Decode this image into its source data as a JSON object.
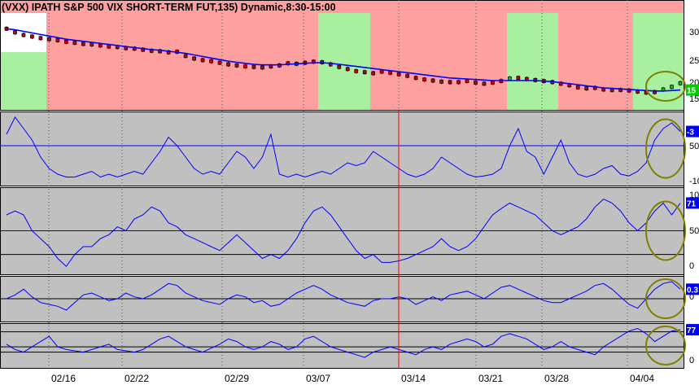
{
  "chart_data": {
    "type": "line",
    "title": "(VXX) IPATH S&P 500 VIX SHORT-TERM FUT,135) Dynamic,8:30-15:00",
    "x_tick_labels": [
      "02/16",
      "02/22",
      "02/29",
      "03/07",
      "03/14",
      "03/21",
      "03/28",
      "04/04"
    ],
    "n_bars": 80,
    "vertical_marker_label": "03/14",
    "background_regimes": [
      {
        "from": "start",
        "to": "02/16",
        "color": "#a8f0a0"
      },
      {
        "from": "02/16",
        "to": "03/07",
        "color": "#ffa0a0"
      },
      {
        "from": "03/07",
        "to": "03/14",
        "color": "#a8f0a0"
      },
      {
        "from": "03/14",
        "to": "03/21",
        "color": "#ffa0a0"
      },
      {
        "from": "03/21",
        "to": "03/28",
        "color": "#a8f0a0"
      },
      {
        "from": "03/28",
        "to": "04/04",
        "color": "#ffa0a0"
      },
      {
        "from": "04/04",
        "to": "end",
        "color": "#a8f0a0"
      }
    ],
    "panels": [
      {
        "name": "price",
        "y_tick_labels": [
          "30",
          "25",
          "20",
          "15"
        ],
        "ylim": [
          13.5,
          32
        ],
        "last_value_label": "15",
        "series": [
          {
            "name": "",
            "kind": "candles",
            "values": [
              29,
              28.3,
              27.8,
              27.5,
              27.2,
              27,
              26.8,
              26.5,
              26.3,
              26.1,
              26,
              25.8,
              25.6,
              25.5,
              25.3,
              25.2,
              25,
              24.8,
              24.7,
              24.5,
              24.6,
              23.8,
              23.3,
              23,
              22.8,
              22.5,
              22.2,
              22,
              21.8,
              21.7,
              21.6,
              21.8,
              22,
              22.4,
              22.3,
              22.5,
              22.7,
              22.6,
              22.2,
              21.7,
              21.3,
              20.9,
              20.7,
              20.5,
              20.8,
              20.6,
              20.3,
              20,
              19.6,
              19.3,
              19.1,
              18.9,
              18.8,
              18.8,
              19,
              18.7,
              18.5,
              18.7,
              19,
              19.5,
              19.6,
              19.4,
              19.2,
              19,
              18.8,
              18.5,
              18.2,
              17.8,
              17.6,
              17.7,
              17.4,
              17.3,
              17.3,
              17.2,
              17,
              16.8,
              16.9,
              17.4,
              17.9,
              18.6
            ]
          },
          {
            "name": "",
            "kind": "moving-average",
            "values": [
              29,
              28.8,
              28.5,
              28.2,
              27.9,
              27.6,
              27.3,
              27,
              26.8,
              26.6,
              26.4,
              26.2,
              26,
              25.8,
              25.6,
              25.4,
              25.2,
              25,
              24.9,
              24.7,
              24.5,
              24.3,
              24,
              23.7,
              23.4,
              23.1,
              22.8,
              22.6,
              22.4,
              22.2,
              22.1,
              22.1,
              22.1,
              22.2,
              22.3,
              22.4,
              22.5,
              22.5,
              22.4,
              22.2,
              22,
              21.8,
              21.6,
              21.4,
              21.2,
              21,
              20.8,
              20.6,
              20.4,
              20.2,
              20,
              19.8,
              19.6,
              19.5,
              19.4,
              19.3,
              19.2,
              19.1,
              19.1,
              19.1,
              19.1,
              19.1,
              19.1,
              19,
              18.9,
              18.7,
              18.5,
              18.3,
              18.1,
              17.9,
              17.7,
              17.6,
              17.5,
              17.4,
              17.3,
              17.2,
              17.1,
              17.1,
              17.2,
              17.3
            ]
          }
        ]
      },
      {
        "name": "indicator-1",
        "y_tick_labels": [
          "50",
          "-10"
        ],
        "ylim": [
          -20,
          110
        ],
        "ref_lines": [
          {
            "value": 50,
            "color": "#0000ff"
          }
        ],
        "last_value_label": "-3",
        "series": [
          {
            "name": "",
            "kind": "line",
            "values": [
              70,
              100,
              80,
              60,
              30,
              10,
              0,
              -5,
              -5,
              0,
              5,
              -5,
              0,
              -5,
              0,
              5,
              0,
              20,
              40,
              65,
              50,
              30,
              10,
              0,
              5,
              0,
              20,
              40,
              30,
              10,
              30,
              70,
              0,
              -5,
              0,
              -5,
              0,
              5,
              0,
              10,
              20,
              15,
              20,
              40,
              30,
              20,
              10,
              0,
              -5,
              0,
              10,
              30,
              20,
              10,
              0,
              -5,
              -3,
              0,
              10,
              50,
              80,
              40,
              30,
              0,
              30,
              60,
              20,
              0,
              -5,
              0,
              10,
              15,
              0,
              -3,
              5,
              20,
              60,
              80,
              90,
              75
            ]
          }
        ]
      },
      {
        "name": "indicator-2",
        "y_tick_labels": [
          "100",
          "50",
          "0"
        ],
        "ylim": [
          -5,
          105
        ],
        "ref_lines": [
          {
            "value": 50,
            "color": "#0000ff"
          },
          {
            "value": 20,
            "color": "#000000"
          }
        ],
        "last_value_label": "71",
        "series": [
          {
            "name": "",
            "kind": "line",
            "values": [
              70,
              75,
              70,
              50,
              40,
              30,
              15,
              5,
              20,
              30,
              30,
              40,
              45,
              55,
              50,
              65,
              70,
              80,
              75,
              60,
              55,
              45,
              40,
              35,
              30,
              25,
              35,
              45,
              35,
              25,
              15,
              20,
              15,
              25,
              40,
              60,
              75,
              80,
              70,
              55,
              40,
              25,
              15,
              20,
              10,
              10,
              12,
              15,
              20,
              25,
              30,
              40,
              30,
              25,
              30,
              40,
              55,
              70,
              78,
              85,
              80,
              75,
              70,
              60,
              50,
              45,
              50,
              55,
              65,
              80,
              90,
              85,
              75,
              60,
              50,
              60,
              75,
              85,
              70,
              85
            ]
          }
        ]
      },
      {
        "name": "indicator-3",
        "y_tick_labels": [
          "0"
        ],
        "ylim": [
          -1.2,
          1.2
        ],
        "ref_lines": [
          {
            "value": 0,
            "color": "#000000"
          }
        ],
        "last_value_label": "0.3",
        "series": [
          {
            "name": "",
            "kind": "line",
            "values": [
              0,
              0.2,
              0.5,
              0.1,
              -0.2,
              -0.3,
              -0.4,
              -0.6,
              -0.2,
              0.2,
              0.3,
              0.1,
              -0.1,
              0,
              0.3,
              0.1,
              0,
              0.2,
              0.5,
              0.8,
              0.7,
              0.3,
              0.1,
              -0.1,
              -0.2,
              -0.3,
              0,
              0.2,
              0.1,
              -0.2,
              -0.1,
              -0.4,
              -0.3,
              0,
              0.3,
              0.5,
              0.7,
              0.5,
              0.2,
              0,
              -0.2,
              -0.3,
              -0.4,
              -0.1,
              0,
              0,
              0.1,
              0,
              -0.3,
              -0.1,
              0.1,
              -0.1,
              0.2,
              0.3,
              0.4,
              0.2,
              0,
              0.3,
              0.6,
              0.7,
              0.5,
              0.3,
              0.1,
              -0.1,
              -0.2,
              -0.2,
              0,
              0.2,
              0.4,
              0.7,
              0.8,
              0.5,
              0.1,
              -0.3,
              -0.5,
              0,
              0.5,
              0.8,
              0.9,
              0.5
            ]
          }
        ]
      },
      {
        "name": "indicator-4",
        "y_tick_labels": [
          "0"
        ],
        "ylim": [
          -60,
          110
        ],
        "ref_lines": [
          {
            "value": 77,
            "color": "#000000"
          },
          {
            "value": 20,
            "color": "#000000"
          },
          {
            "value": 0,
            "color": "#000000"
          }
        ],
        "last_value_label": "77",
        "series": [
          {
            "name": "",
            "kind": "line",
            "values": [
              30,
              10,
              0,
              20,
              40,
              60,
              20,
              10,
              5,
              0,
              10,
              20,
              30,
              10,
              5,
              0,
              10,
              30,
              50,
              60,
              40,
              20,
              10,
              0,
              15,
              30,
              50,
              40,
              20,
              10,
              20,
              40,
              30,
              10,
              20,
              50,
              60,
              40,
              20,
              10,
              0,
              -10,
              -20,
              0,
              10,
              20,
              10,
              0,
              -10,
              10,
              20,
              10,
              30,
              40,
              50,
              40,
              20,
              30,
              60,
              70,
              60,
              50,
              30,
              10,
              20,
              40,
              20,
              10,
              0,
              -10,
              20,
              40,
              60,
              80,
              90,
              70,
              40,
              60,
              80,
              85
            ]
          }
        ]
      }
    ]
  }
}
